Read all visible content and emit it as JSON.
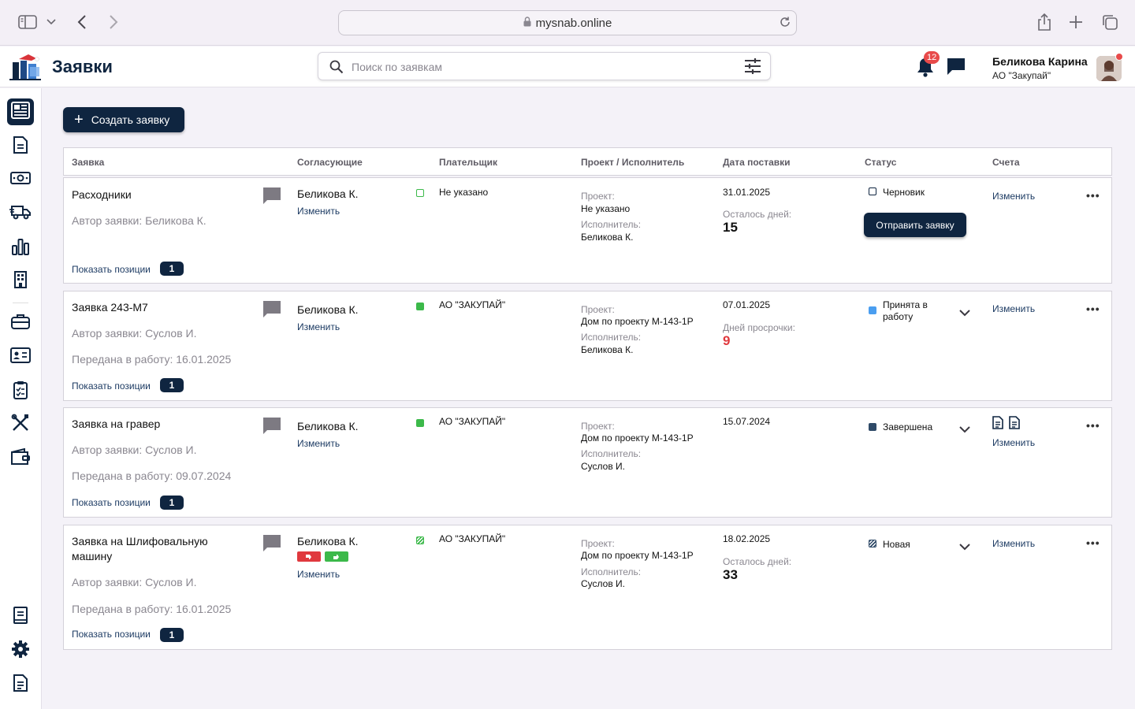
{
  "browser": {
    "url": "mysnab.online"
  },
  "header": {
    "title": "Заявки",
    "search_placeholder": "Поиск по заявкам",
    "notifications_count": "12",
    "user_name": "Беликова Карина",
    "user_org": "АО \"Закупай\""
  },
  "main": {
    "create_label": "Создать заявку"
  },
  "table": {
    "headers": [
      "Заявка",
      "Согласующие",
      "Плательщик",
      "Проект / Исполнитель",
      "Дата поставки",
      "Статус",
      "Счета"
    ],
    "rows": [
      {
        "title": "Расходники",
        "author": "Автор заявки:  Беликова К.",
        "show_positions": "Показать позиции",
        "positions_count": "1",
        "approver": "Беликова К.",
        "approver_change": "Изменить",
        "payer": "Не указано",
        "project_label": "Проект:",
        "project": "Не указано",
        "executor_label": "Исполнитель:",
        "executor": "Беликова К.",
        "date": "31.01.2025",
        "days_label": "Осталось дней:",
        "days": "15",
        "status": "Черновик",
        "send_label": "Отправить заявку",
        "invoice_change": "Изменить",
        "more": "•••"
      },
      {
        "title": "Заявка 243-М7",
        "author": "Автор заявки:  Суслов И.",
        "sent": "Передана в работу: 16.01.2025",
        "show_positions": "Показать позиции",
        "positions_count": "1",
        "approver": "Беликова К.",
        "approver_change": "Изменить",
        "payer": "АО \"ЗАКУПАЙ\"",
        "project_label": "Проект:",
        "project": "Дом по проекту М-143-1Р",
        "executor_label": "Исполнитель:",
        "executor": "Беликова К.",
        "date": "07.01.2025",
        "days_label": "Дней просрочки:",
        "days": "9",
        "status": "Принята в работу",
        "invoice_change": "Изменить",
        "more": "•••"
      },
      {
        "title": "Заявка на гравер",
        "author": "Автор заявки:  Суслов И.",
        "sent": "Передана в работу: 09.07.2024",
        "show_positions": "Показать позиции",
        "positions_count": "1",
        "approver": "Беликова К.",
        "approver_change": "Изменить",
        "payer": "АО \"ЗАКУПАЙ\"",
        "project_label": "Проект:",
        "project": "Дом по проекту М-143-1Р",
        "executor_label": "Исполнитель:",
        "executor": "Суслов И.",
        "date": "15.07.2024",
        "status": "Завершена",
        "invoice_change": "Изменить",
        "more": "•••"
      },
      {
        "title": "Заявка на Шлифовальную машину",
        "author": "Автор заявки:  Суслов И.",
        "sent": "Передана в работу: 16.01.2025",
        "show_positions": "Показать позиции",
        "positions_count": "1",
        "approver": "Беликова К.",
        "approver_change": "Изменить",
        "payer": "АО \"ЗАКУПАЙ\"",
        "project_label": "Проект:",
        "project": "Дом по проекту М-143-1Р",
        "executor_label": "Исполнитель:",
        "executor": "Суслов И.",
        "date": "18.02.2025",
        "days_label": "Осталось дней:",
        "days": "33",
        "status": "Новая",
        "invoice_change": "Изменить",
        "more": "•••"
      }
    ]
  },
  "colors": {
    "primary": "#0f2540",
    "link": "#1d3b63",
    "green": "#3cb94a",
    "blue_status": "#4a9ef0",
    "dark_status": "#2f4a68",
    "overdue": "#e0393e",
    "badge": "#e84a4a"
  },
  "icons": [
    "sidebar-toggle-icon",
    "chevron-down-icon",
    "back-icon",
    "forward-icon",
    "lock-icon",
    "reload-icon",
    "share-icon",
    "new-tab-icon",
    "tabs-icon",
    "search-icon",
    "filter-icon",
    "bell-icon",
    "chat-icon",
    "comment-icon",
    "document-icon",
    "more-icon"
  ]
}
